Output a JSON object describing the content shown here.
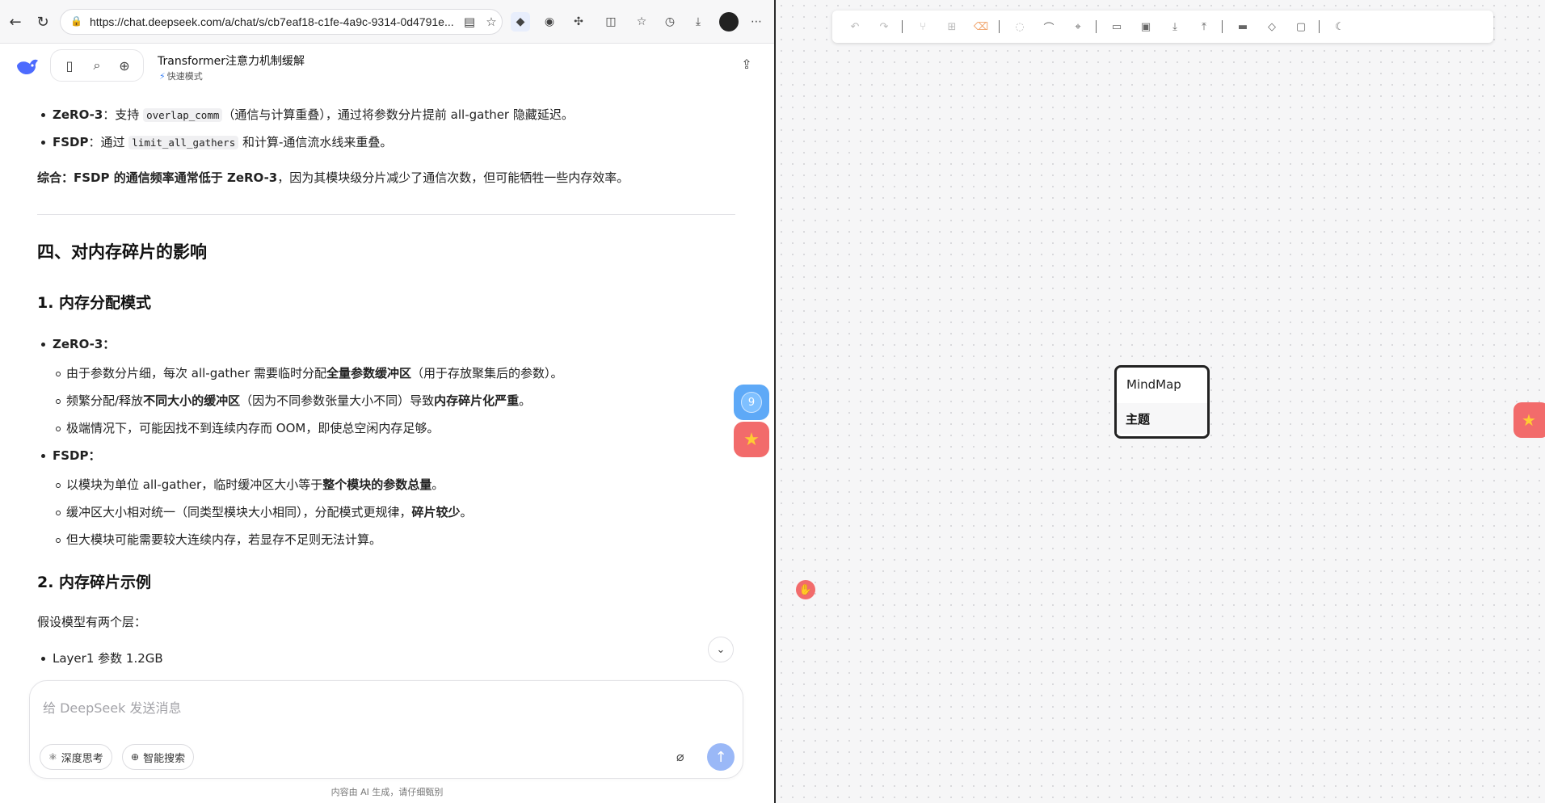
{
  "browser": {
    "url": "https://chat.deepseek.com/a/chat/s/cb7eaf18-c1fe-4a9c-9314-0d4791e..."
  },
  "app": {
    "chat_title": "Transformer注意力机制缓解",
    "mode": "快速模式"
  },
  "content": {
    "bullet_zero3_label": "ZeRO-3",
    "bullet_zero3_pre": "：支持 ",
    "bullet_zero3_code": "overlap_comm",
    "bullet_zero3_post": "（通信与计算重叠），通过将参数分片提前 all-gather 隐藏延迟。",
    "bullet_fsdp_label": "FSDP",
    "bullet_fsdp_pre": "：通过 ",
    "bullet_fsdp_code": "limit_all_gathers",
    "bullet_fsdp_post": " 和计算-通信流水线来重叠。",
    "summary_bold": "综合：FSDP 的通信频率通常低于 ZeRO-3",
    "summary_rest": "，因为其模块级分片减少了通信次数，但可能牺牲一些内存效率。",
    "section4_title": "四、对内存碎片的影响",
    "sub1_title": "1. 内存分配模式",
    "z3_head": "ZeRO-3：",
    "z3_i1_pre": "由于参数分片细，每次 all-gather 需要临时分配",
    "z3_i1_bold": "全量参数缓冲区",
    "z3_i1_post": "（用于存放聚集后的参数）。",
    "z3_i2_pre": "频繁分配/释放",
    "z3_i2_bold": "不同大小的缓冲区",
    "z3_i2_mid": "（因为不同参数张量大小不同）导致",
    "z3_i2_bold2": "内存碎片化严重",
    "z3_i2_post": "。",
    "z3_i3": "极端情况下，可能因找不到连续内存而 OOM，即使总空闲内存足够。",
    "fsdp_head": "FSDP：",
    "fsdp_i1_pre": "以模块为单位 all-gather，临时缓冲区大小等于",
    "fsdp_i1_bold": "整个模块的参数总量",
    "fsdp_i1_post": "。",
    "fsdp_i2_pre": "缓冲区大小相对统一（同类型模块大小相同），分配模式更规律，",
    "fsdp_i2_bold": "碎片较少",
    "fsdp_i2_post": "。",
    "fsdp_i3": "但大模块可能需要较大连续内存，若显存不足则无法计算。",
    "sub2_title": "2. 内存碎片示例",
    "example_intro": "假设模型有两个层：",
    "example_i1": "Layer1 参数 1.2GB"
  },
  "floating": {
    "count_badge": "9"
  },
  "input": {
    "placeholder": "给 DeepSeek 发送消息",
    "deep_think": "深度思考",
    "web_search": "智能搜索",
    "disclaimer": "内容由 AI 生成，请仔细甄别"
  },
  "mindmap": {
    "root": "MindMap",
    "topic": "主题"
  },
  "colors": {
    "accent_blue": "#5ea9f7",
    "float_red": "#f26b6b",
    "star_yellow": "#ffcc33",
    "send_blue": "#9ab8f7"
  },
  "icons": [
    "back-icon",
    "refresh-icon",
    "lock-icon",
    "reader-icon",
    "favorite-icon",
    "extension-icon",
    "split-screen-icon",
    "collections-icon",
    "history-icon",
    "download-icon",
    "more-icon",
    "sidebar-icon",
    "search-icon",
    "new-chat-icon",
    "share-icon",
    "star-icon",
    "paperclip-icon",
    "send-arrow-icon",
    "undo-icon",
    "redo-icon",
    "hand-cursor-icon"
  ]
}
